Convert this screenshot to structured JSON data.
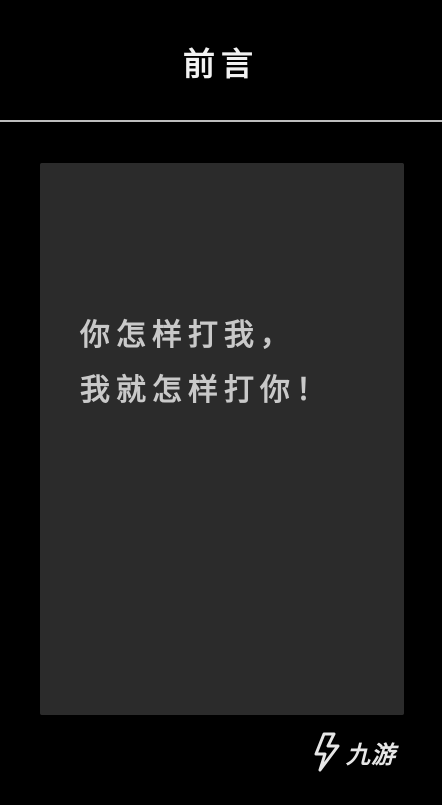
{
  "header": {
    "title": "前言"
  },
  "panel": {
    "lines": [
      "你怎样打我，",
      "我就怎样打你！"
    ]
  },
  "watermark": {
    "text": "九游",
    "icon": "nine-game-logo-icon"
  },
  "colors": {
    "background": "#000000",
    "panel": "#2b2b2b",
    "divider": "#bdbdbd",
    "panel_text": "#c9c9c9",
    "title": "#f2f2f2"
  }
}
